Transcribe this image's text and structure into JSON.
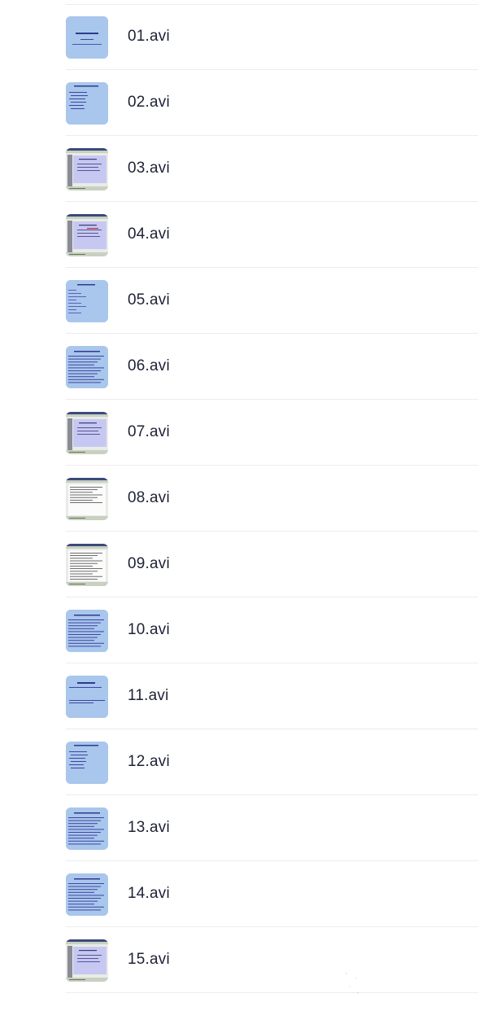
{
  "files": [
    {
      "name": "01.avi",
      "icon": "video-thumbnail-icon",
      "style": "slide-title"
    },
    {
      "name": "02.avi",
      "icon": "video-thumbnail-icon",
      "style": "slide-list"
    },
    {
      "name": "03.avi",
      "icon": "video-thumbnail-icon",
      "style": "window-purple"
    },
    {
      "name": "04.avi",
      "icon": "video-thumbnail-icon",
      "style": "window-purple-red"
    },
    {
      "name": "05.avi",
      "icon": "video-thumbnail-icon",
      "style": "slide-sparse"
    },
    {
      "name": "06.avi",
      "icon": "video-thumbnail-icon",
      "style": "slide-dense"
    },
    {
      "name": "07.avi",
      "icon": "video-thumbnail-icon",
      "style": "window-purple"
    },
    {
      "name": "08.avi",
      "icon": "video-thumbnail-icon",
      "style": "window-white"
    },
    {
      "name": "09.avi",
      "icon": "video-thumbnail-icon",
      "style": "window-text"
    },
    {
      "name": "10.avi",
      "icon": "video-thumbnail-icon",
      "style": "slide-dense"
    },
    {
      "name": "11.avi",
      "icon": "video-thumbnail-icon",
      "style": "slide-title2"
    },
    {
      "name": "12.avi",
      "icon": "video-thumbnail-icon",
      "style": "slide-list"
    },
    {
      "name": "13.avi",
      "icon": "video-thumbnail-icon",
      "style": "slide-dense"
    },
    {
      "name": "14.avi",
      "icon": "video-thumbnail-icon",
      "style": "slide-dense"
    },
    {
      "name": "15.avi",
      "icon": "video-thumbnail-icon",
      "style": "window-purple"
    }
  ],
  "colors": {
    "slide_bg": "#a9c6ec",
    "window_bg": "#e9ece6",
    "window_panel": "#c7c8f2",
    "text_dark": "#1f2235",
    "divider": "#ececf1"
  }
}
